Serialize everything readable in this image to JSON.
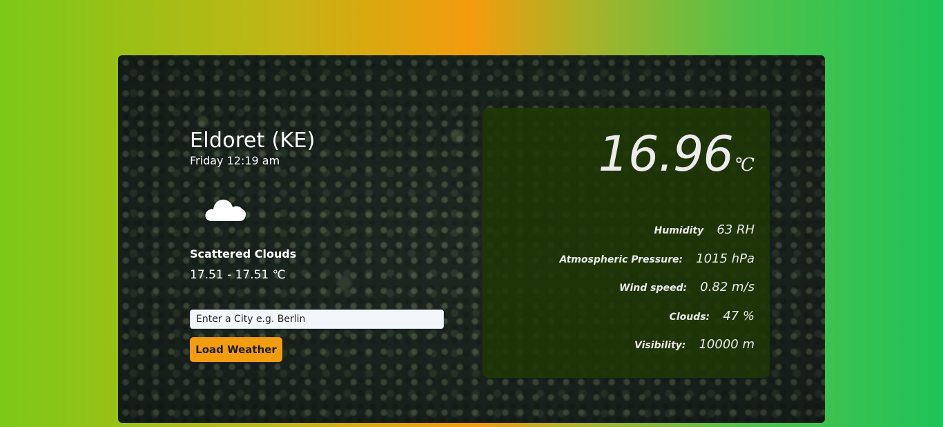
{
  "location": {
    "city": "Eldoret (KE)",
    "datetime": "Friday 12:19 am"
  },
  "condition": {
    "icon": "cloud-icon",
    "description": "Scattered Clouds",
    "range": "17.51 - 17.51 ℃"
  },
  "search": {
    "placeholder": "Enter a City e.g. Berlin",
    "button_label": "Load Weather"
  },
  "current": {
    "temperature": "16.96",
    "unit": "℃"
  },
  "stats": [
    {
      "label": "Humidity",
      "value": "63 RH"
    },
    {
      "label": "Atmospheric Pressure:",
      "value": "1015 hPa"
    },
    {
      "label": "Wind speed:",
      "value": "0.82 m/s"
    },
    {
      "label": "Clouds:",
      "value": "47 %"
    },
    {
      "label": "Visibility:",
      "value": "10000 m"
    }
  ],
  "colors": {
    "accent": "#f29c10",
    "panel": "#1e3704"
  }
}
